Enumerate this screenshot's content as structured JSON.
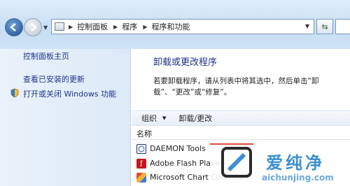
{
  "address_bar": {
    "crumbs": [
      "控制面板",
      "程序",
      "程序和功能"
    ]
  },
  "left_pane": {
    "home_link": "控制面板主页",
    "view_updates_link": "查看已安装的更新",
    "windows_features_link": "打开或关闭 Windows 功能"
  },
  "main": {
    "title": "卸载或更改程序",
    "description": "若要卸载程序，请从列表中将其选中，然后单击“卸载”、“更改”或“修复”。",
    "toolbar": {
      "organize_label": "组织",
      "uninstall_change_label": "卸载/更改"
    },
    "column_header": "名称",
    "programs": [
      {
        "name": "DAEMON Tools",
        "icon": "daemon-tools-icon"
      },
      {
        "name": "Adobe Flash Player",
        "icon": "flash-icon"
      },
      {
        "name": "Microsoft Chart Controls",
        "icon": "chart-icon"
      }
    ]
  },
  "watermark": {
    "text": "爱纯净",
    "url": "aichunjing.com"
  }
}
